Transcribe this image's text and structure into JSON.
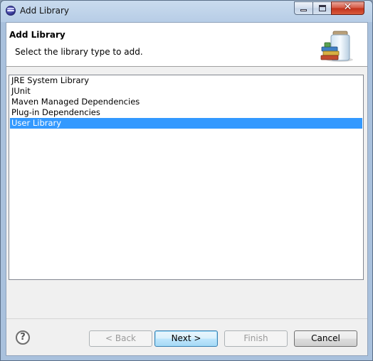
{
  "window": {
    "title": "Add Library"
  },
  "header": {
    "title": "Add Library",
    "description": "Select the library type to add."
  },
  "library_types": [
    {
      "label": "JRE System Library",
      "selected": false
    },
    {
      "label": "JUnit",
      "selected": false
    },
    {
      "label": "Maven Managed Dependencies",
      "selected": false
    },
    {
      "label": "Plug-in Dependencies",
      "selected": false
    },
    {
      "label": "User Library",
      "selected": true
    }
  ],
  "buttons": {
    "help": "?",
    "back": "< Back",
    "next": "Next >",
    "finish": "Finish",
    "cancel": "Cancel"
  },
  "colors": {
    "selection": "#3399ff",
    "close_button": "#c2311b"
  },
  "icons": {
    "app": "eclipse-icon",
    "wizard": "library-jar-icon"
  }
}
